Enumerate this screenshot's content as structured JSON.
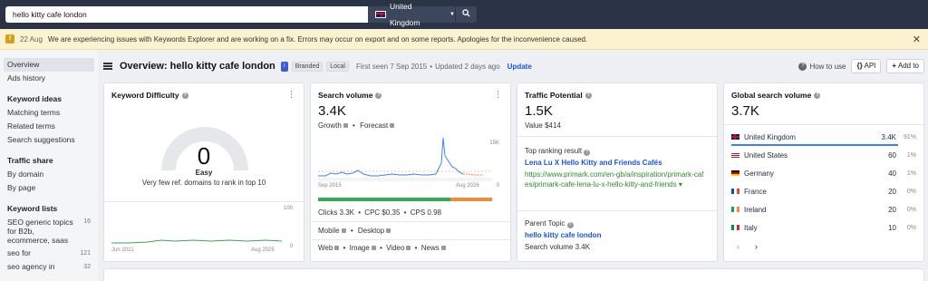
{
  "search": {
    "query": "hello kitty cafe london",
    "country": "United Kingdom"
  },
  "banner": {
    "date": "22 Aug",
    "text": "We are experiencing issues with Keywords Explorer and are working on a fix. Errors may occur on export and on some reports. Apologies for the inconvenience caused."
  },
  "sidebar": {
    "overview": "Overview",
    "ads_history": "Ads history",
    "ideas_head": "Keyword ideas",
    "matching": "Matching terms",
    "related": "Related terms",
    "suggestions": "Search suggestions",
    "traffic_head": "Traffic share",
    "by_domain": "By domain",
    "by_page": "By page",
    "lists_head": "Keyword lists",
    "lists": [
      {
        "name": "SEO generic topics for B2b, ecommerce, saas",
        "count": "16"
      },
      {
        "name": "seo for",
        "count": "121"
      },
      {
        "name": "seo agency in",
        "count": "32"
      }
    ]
  },
  "header": {
    "title": "Overview: hello kitty cafe london",
    "info": "i",
    "tag_branded": "Branded",
    "tag_local": "Local",
    "first_seen": "First seen 7 Sep 2015",
    "updated": "Updated 2 days ago",
    "update_link": "Update",
    "how_to_use": "How to use",
    "api": "API",
    "add_to": "Add to"
  },
  "kd": {
    "title": "Keyword Difficulty",
    "value": "0",
    "label": "Easy",
    "desc": "Very few ref. domains to rank in top 10",
    "axis_max": "100",
    "axis_min": "0",
    "date_start": "Jun 2021",
    "date_end": "Aug 2025"
  },
  "sv": {
    "title": "Search volume",
    "value": "3.4K",
    "growth": "Growth",
    "forecast": "Forecast",
    "axis_max": "15K",
    "axis_min": "0",
    "date_start": "Sep 2015",
    "date_end": "Aug 2026",
    "clicks": "Clicks 3.3K",
    "cpc": "CPC $0.35",
    "cps": "CPS 0.98",
    "mobile": "Mobile",
    "desktop": "Desktop",
    "web": "Web",
    "image": "Image",
    "video": "Video",
    "news": "News",
    "click_share": 0.76
  },
  "tp": {
    "title": "Traffic Potential",
    "value": "1.5K",
    "value_sub": "Value $414",
    "top_label": "Top ranking result",
    "top_title": "Lena Lu X Hello Kitty and Friends Cafés",
    "top_url": "https://www.primark.com/en-gb/a/inspiration/primark-cafes/primark-cafe-lena-lu-x-hello-kitty-and-friends",
    "parent_label": "Parent Topic",
    "parent_link": "hello kitty cafe london",
    "parent_sv": "Search volume 3.4K"
  },
  "gsv": {
    "title": "Global search volume",
    "value": "3.7K",
    "rows": [
      {
        "country": "United Kingdom",
        "value": "3.4K",
        "pct": "91%",
        "share": 0.91
      },
      {
        "country": "United States",
        "value": "60",
        "pct": "1%",
        "share": 0.01
      },
      {
        "country": "Germany",
        "value": "40",
        "pct": "1%",
        "share": 0.01
      },
      {
        "country": "France",
        "value": "20",
        "pct": "0%",
        "share": 0
      },
      {
        "country": "Ireland",
        "value": "20",
        "pct": "0%",
        "share": 0
      },
      {
        "country": "Italy",
        "value": "10",
        "pct": "0%",
        "share": 0
      }
    ]
  },
  "colors": {
    "accent": "#1a56db",
    "chart_line": "#3b82f6",
    "green": "#3aa657",
    "orange": "#f08c3a"
  }
}
